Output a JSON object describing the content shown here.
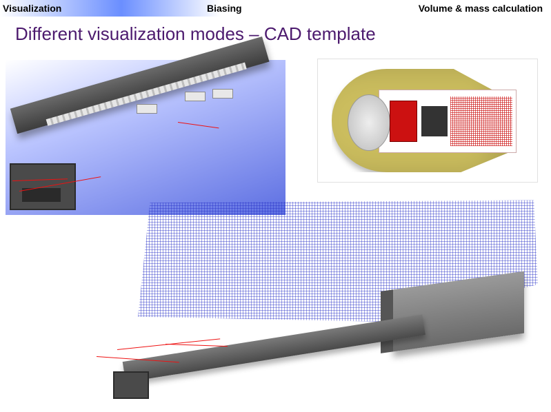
{
  "tabs": {
    "left": "Visualization",
    "mid": "Biasing",
    "right": "Volume & mass calculation"
  },
  "title": "Different visualization modes – CAD template"
}
